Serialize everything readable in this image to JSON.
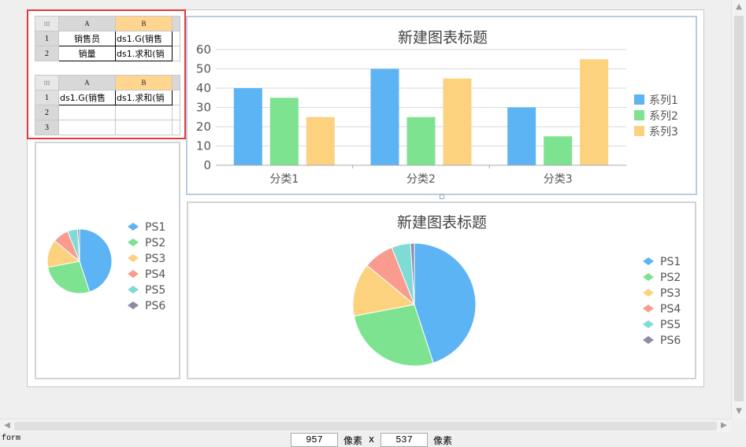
{
  "sheet1": {
    "columns": [
      "A",
      "B"
    ],
    "rows": [
      {
        "num": "1",
        "a": "销售员",
        "b": "ds1.G(销售"
      },
      {
        "num": "2",
        "a": "销量",
        "b": "ds1.求和(销"
      }
    ]
  },
  "sheet2": {
    "columns": [
      "A",
      "B"
    ],
    "rows": [
      {
        "num": "1",
        "a": "ds1.G(销售",
        "b": "ds1.求和(销"
      },
      {
        "num": "2",
        "a": "",
        "b": ""
      },
      {
        "num": "3",
        "a": "",
        "b": ""
      }
    ]
  },
  "charts": {
    "bar_title": "新建图表标题",
    "pie_title": "新建图表标题"
  },
  "chart_data": [
    {
      "type": "bar",
      "title": "新建图表标题",
      "categories": [
        "分类1",
        "分类2",
        "分类3"
      ],
      "series": [
        {
          "name": "系列1",
          "values": [
            40,
            50,
            30
          ],
          "color": "#5cb4f5"
        },
        {
          "name": "系列2",
          "values": [
            35,
            25,
            15
          ],
          "color": "#7ee390"
        },
        {
          "name": "系列3",
          "values": [
            25,
            45,
            55
          ],
          "color": "#fcd27e"
        }
      ],
      "ylim": [
        0,
        60
      ],
      "yticks": [
        0,
        10,
        20,
        30,
        40,
        50,
        60
      ],
      "grid": true,
      "legend": "right"
    },
    {
      "type": "pie",
      "title": "",
      "labels": [
        "PS1",
        "PS2",
        "PS3",
        "PS4",
        "PS5",
        "PS6"
      ],
      "values": [
        45,
        27,
        14,
        8,
        5,
        1
      ],
      "colors": [
        "#5cb4f5",
        "#7ee390",
        "#fcd27e",
        "#f99b8e",
        "#7fdbd6",
        "#8c8ca6"
      ],
      "legend": "right"
    },
    {
      "type": "pie",
      "title": "新建图表标题",
      "labels": [
        "PS1",
        "PS2",
        "PS3",
        "PS4",
        "PS5",
        "PS6"
      ],
      "values": [
        45,
        27,
        14,
        8,
        5,
        1
      ],
      "colors": [
        "#5cb4f5",
        "#7ee390",
        "#fcd27e",
        "#f99b8e",
        "#7fdbd6",
        "#8c8ca6"
      ],
      "legend": "right"
    }
  ],
  "status": {
    "mode": "form",
    "width": "957",
    "unit1": "像素",
    "sep": "x",
    "height": "537",
    "unit2": "像素"
  },
  "icons": {
    "scroll_up": "triangle-up-icon",
    "scroll_down": "triangle-down-icon",
    "scroll_left": "triangle-left-icon",
    "scroll_right": "triangle-right-icon"
  }
}
